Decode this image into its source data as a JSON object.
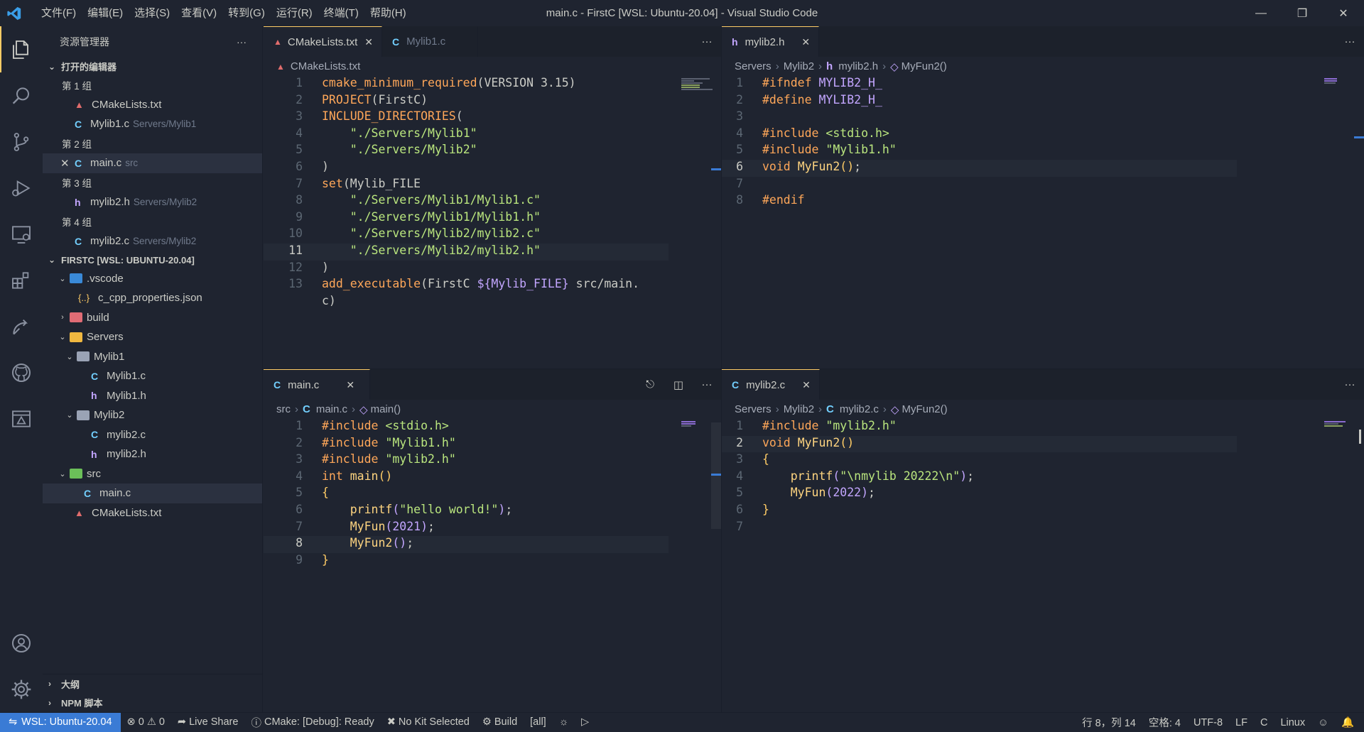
{
  "titlebar": {
    "menus": [
      "文件(F)",
      "编辑(E)",
      "选择(S)",
      "查看(V)",
      "转到(G)",
      "运行(R)",
      "终端(T)",
      "帮助(H)"
    ],
    "title": "main.c - FirstC [WSL: Ubuntu-20.04] - Visual Studio Code"
  },
  "sidebar": {
    "title": "资源管理器",
    "open_editors": "打开的编辑器",
    "groups": [
      {
        "label": "第 1 组",
        "files": [
          {
            "name": "CMakeLists.txt",
            "desc": ""
          },
          {
            "name": "Mylib1.c",
            "desc": "Servers/Mylib1"
          }
        ]
      },
      {
        "label": "第 2 组",
        "files": [
          {
            "name": "main.c",
            "desc": "src"
          }
        ]
      },
      {
        "label": "第 3 组",
        "files": [
          {
            "name": "mylib2.h",
            "desc": "Servers/Mylib2"
          }
        ]
      },
      {
        "label": "第 4 组",
        "files": [
          {
            "name": "mylib2.c",
            "desc": "Servers/Mylib2"
          }
        ]
      }
    ],
    "workspace": "FIRSTC [WSL: UBUNTU-20.04]",
    "tree": {
      "vscode": ".vscode",
      "cpp_props": "c_cpp_properties.json",
      "build": "build",
      "servers": "Servers",
      "mylib1": "Mylib1",
      "mylib1c": "Mylib1.c",
      "mylib1h": "Mylib1.h",
      "mylib2": "Mylib2",
      "mylib2c": "mylib2.c",
      "mylib2h": "mylib2.h",
      "src": "src",
      "mainc": "main.c",
      "cmake": "CMakeLists.txt"
    },
    "outline": "大纲",
    "npm": "NPM 脚本"
  },
  "panes": {
    "tl": {
      "tabs": [
        "CMakeLists.txt",
        "Mylib1.c"
      ],
      "breadcrumb": [
        "CMakeLists.txt"
      ]
    },
    "tr": {
      "tabs": [
        "mylib2.h"
      ],
      "breadcrumb": [
        "Servers",
        "Mylib2",
        "mylib2.h",
        "MyFun2()"
      ]
    },
    "bl": {
      "tabs": [
        "main.c"
      ],
      "breadcrumb": [
        "src",
        "main.c",
        "main()"
      ]
    },
    "br": {
      "tabs": [
        "mylib2.c"
      ],
      "breadcrumb": [
        "Servers",
        "Mylib2",
        "mylib2.c",
        "MyFun2()"
      ]
    }
  },
  "status": {
    "remote": "WSL: Ubuntu-20.04",
    "errors": "0",
    "warnings": "0",
    "liveshare": "Live Share",
    "cmake": "CMake: [Debug]: Ready",
    "kit": "No Kit Selected",
    "build": "Build",
    "target": "[all]",
    "position": "行 8，列 14",
    "spaces": "空格: 4",
    "encoding": "UTF-8",
    "eol": "LF",
    "lang": "C",
    "os": "Linux"
  }
}
